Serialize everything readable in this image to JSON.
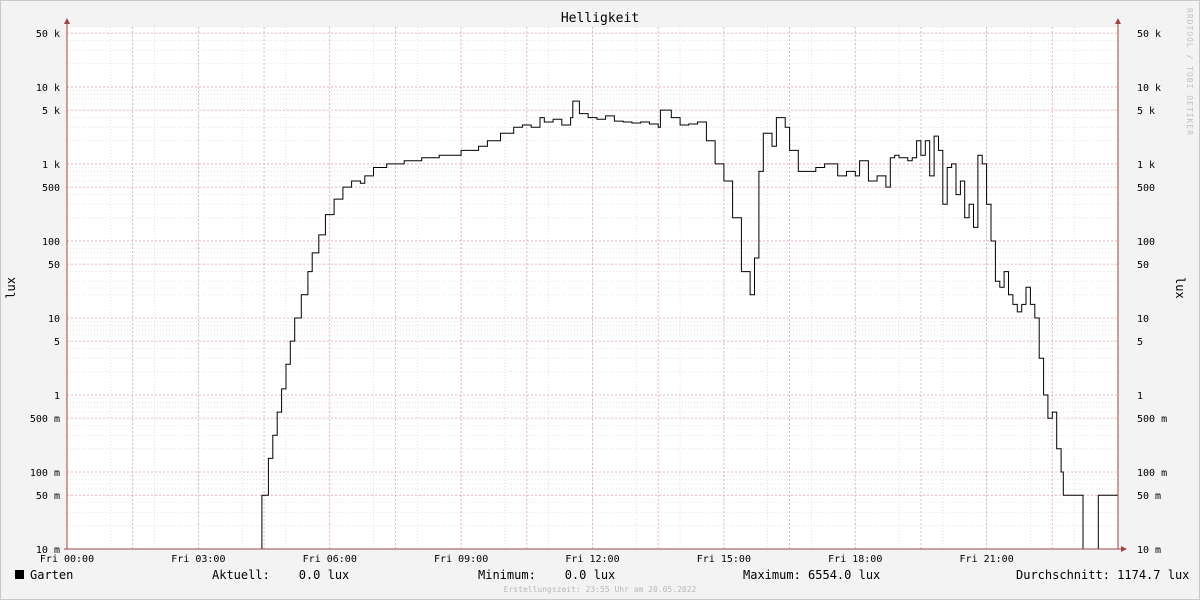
{
  "header": {
    "title": "Helligkeit",
    "watermark": "RRDTOOL / TOBI OETIKER"
  },
  "axis_labels": {
    "left": "lux",
    "right": "lux"
  },
  "legend": {
    "series_name": "Garten",
    "current": "Aktuell:    0.0 lux",
    "minimum": "Minimum:    0.0 lux",
    "maximum": "Maximum: 6554.0 lux",
    "average": "Durchschnitt: 1174.7 lux"
  },
  "footer": "Erstellungszeit: 23:55 Uhr am 20.05.2022",
  "colors": {
    "line": "#000000",
    "major_grid": "#e7a3b4",
    "minor_grid": "#cfcfcf",
    "axis": "#9e4646",
    "background": "#ffffff"
  },
  "chart_data": {
    "type": "line",
    "title": "Helligkeit",
    "ylabel": "lux",
    "y_scale": "log",
    "ylim": [
      0.01,
      60000
    ],
    "xlim_hours": [
      0,
      24
    ],
    "grid": true,
    "x_tick_labels": [
      "Fri 00:00",
      "Fri 03:00",
      "Fri 06:00",
      "Fri 09:00",
      "Fri 12:00",
      "Fri 15:00",
      "Fri 18:00",
      "Fri 21:00"
    ],
    "y_tick_labels": [
      "50 k",
      "10 k",
      "5 k",
      "1 k",
      "500",
      "100",
      "50",
      "10",
      "5",
      "1",
      "500 m",
      "100 m",
      "50 m",
      "10 m"
    ],
    "series": [
      {
        "name": "Garten",
        "x_hours": [
          0,
          4.4,
          4.45,
          4.6,
          4.7,
          4.8,
          4.9,
          5.0,
          5.1,
          5.2,
          5.35,
          5.5,
          5.6,
          5.75,
          5.9,
          6.1,
          6.3,
          6.5,
          6.7,
          6.8,
          7.0,
          7.3,
          7.7,
          8.1,
          8.5,
          9.0,
          9.4,
          9.6,
          9.9,
          10.2,
          10.4,
          10.6,
          10.8,
          10.9,
          11.1,
          11.3,
          11.5,
          11.55,
          11.7,
          11.9,
          12.1,
          12.3,
          12.5,
          12.7,
          12.9,
          13.1,
          13.3,
          13.5,
          13.55,
          13.8,
          14.0,
          14.2,
          14.4,
          14.6,
          14.8,
          15.0,
          15.2,
          15.4,
          15.6,
          15.7,
          15.8,
          15.9,
          16.1,
          16.2,
          16.4,
          16.5,
          16.7,
          16.9,
          17.1,
          17.3,
          17.5,
          17.6,
          17.8,
          18.0,
          18.1,
          18.3,
          18.5,
          18.7,
          18.8,
          18.9,
          19.0,
          19.2,
          19.3,
          19.4,
          19.5,
          19.6,
          19.7,
          19.8,
          19.9,
          20.0,
          20.1,
          20.2,
          20.3,
          20.4,
          20.5,
          20.6,
          20.7,
          20.8,
          20.9,
          21.0,
          21.1,
          21.2,
          21.3,
          21.4,
          21.5,
          21.6,
          21.7,
          21.8,
          21.9,
          22.0,
          22.1,
          22.2,
          22.3,
          22.4,
          22.5,
          22.6,
          22.7,
          22.75,
          23.0,
          23.15,
          23.2,
          23.55,
          23.6,
          24.0
        ],
        "y_values": [
          0.01,
          0.01,
          0.05,
          0.15,
          0.3,
          0.6,
          1.2,
          2.5,
          5,
          10,
          20,
          40,
          70,
          120,
          220,
          350,
          500,
          600,
          560,
          700,
          900,
          1000,
          1100,
          1200,
          1300,
          1500,
          1700,
          2000,
          2500,
          3000,
          3200,
          3000,
          4000,
          3500,
          3800,
          3200,
          4000,
          6554,
          4500,
          4000,
          3800,
          4200,
          3600,
          3500,
          3400,
          3500,
          3300,
          3000,
          5000,
          4000,
          3200,
          3300,
          3500,
          2000,
          1000,
          600,
          200,
          40,
          20,
          60,
          800,
          2500,
          1700,
          4000,
          3000,
          1500,
          800,
          800,
          900,
          1000,
          1000,
          700,
          800,
          700,
          1100,
          600,
          700,
          500,
          1200,
          1300,
          1200,
          1100,
          1200,
          2000,
          1300,
          2000,
          700,
          2300,
          1500,
          300,
          900,
          1000,
          400,
          600,
          200,
          300,
          150,
          1300,
          1000,
          300,
          100,
          30,
          25,
          40,
          20,
          15,
          12,
          15,
          25,
          15,
          10,
          3,
          1,
          0.5,
          0.6,
          0.2,
          0.1,
          0.05,
          0.05,
          0.05,
          0.01,
          0.05,
          0.05,
          0.01,
          0.01
        ]
      }
    ]
  }
}
